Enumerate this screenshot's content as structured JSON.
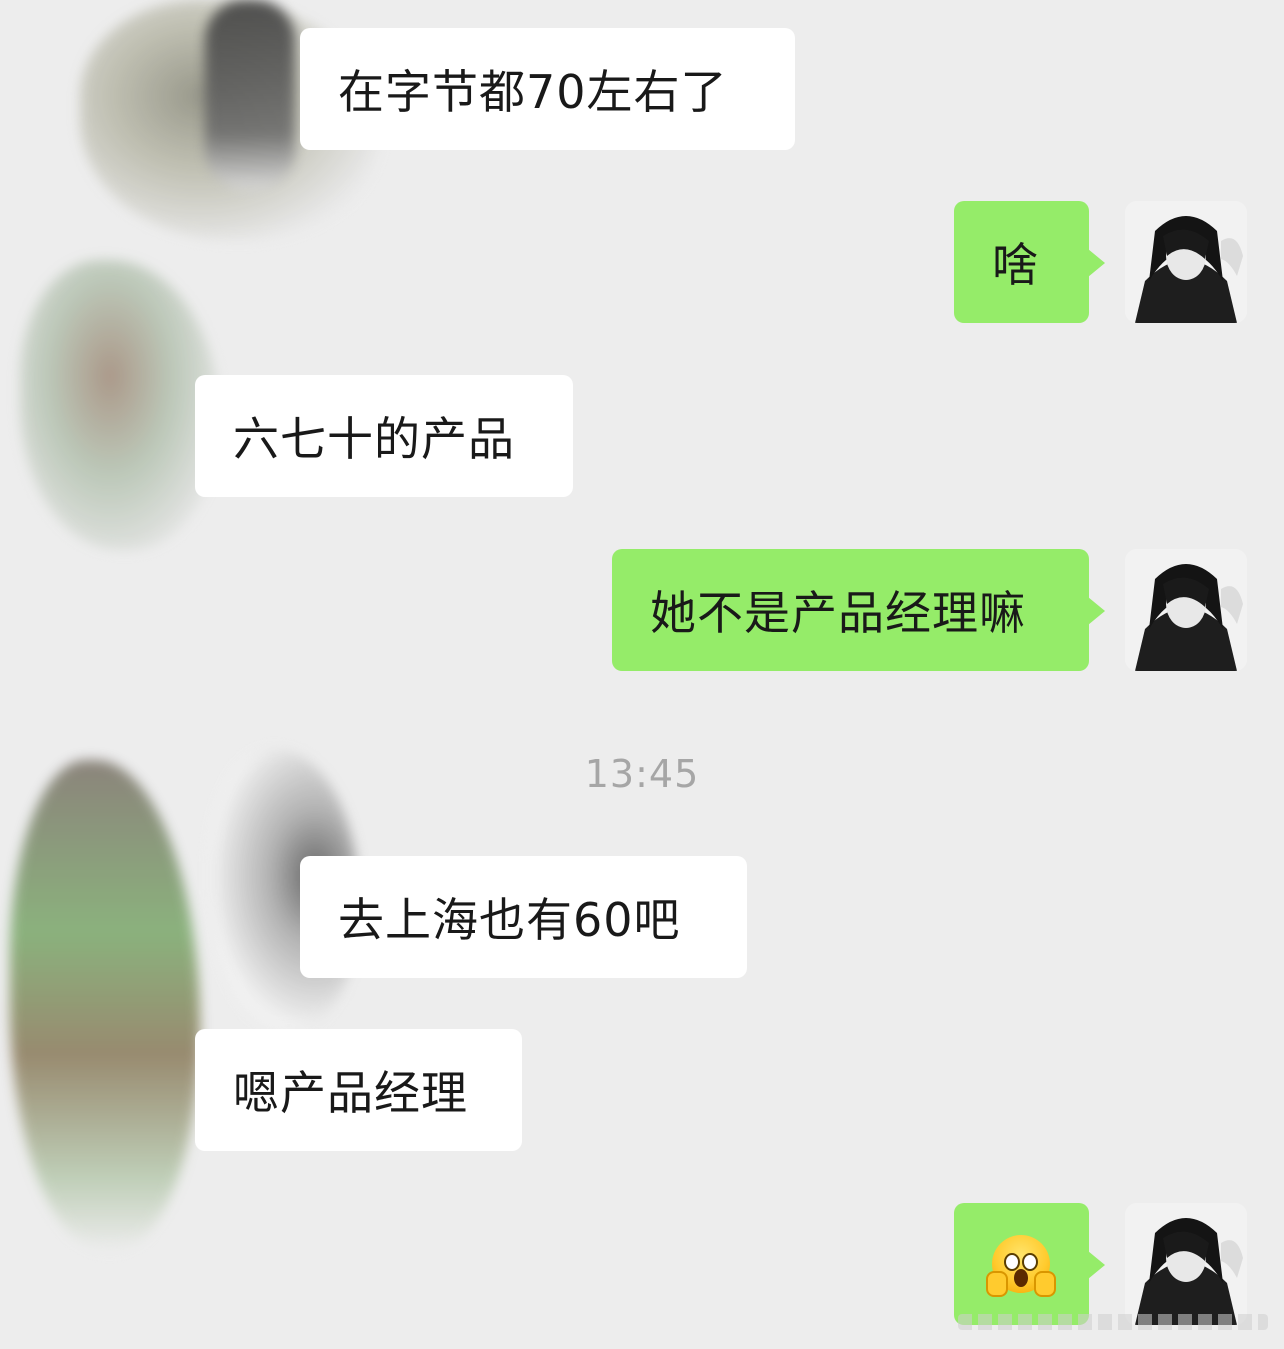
{
  "messages": [
    {
      "side": "in",
      "text": "在字节都70左右了"
    },
    {
      "side": "out",
      "text": "啥"
    },
    {
      "side": "in",
      "text": "六七十的产品"
    },
    {
      "side": "out",
      "text": "她不是产品经理嘛"
    },
    {
      "side": "in",
      "text": "去上海也有60吧"
    },
    {
      "side": "in",
      "text": "嗯产品经理"
    },
    {
      "side": "out",
      "emoji": "face-screaming-in-fear-icon"
    }
  ],
  "timestamp": "13:45",
  "colors": {
    "background": "#ededed",
    "incoming_bubble": "#ffffff",
    "outgoing_bubble": "#95ec69",
    "timestamp_text": "#a6a6a6"
  }
}
